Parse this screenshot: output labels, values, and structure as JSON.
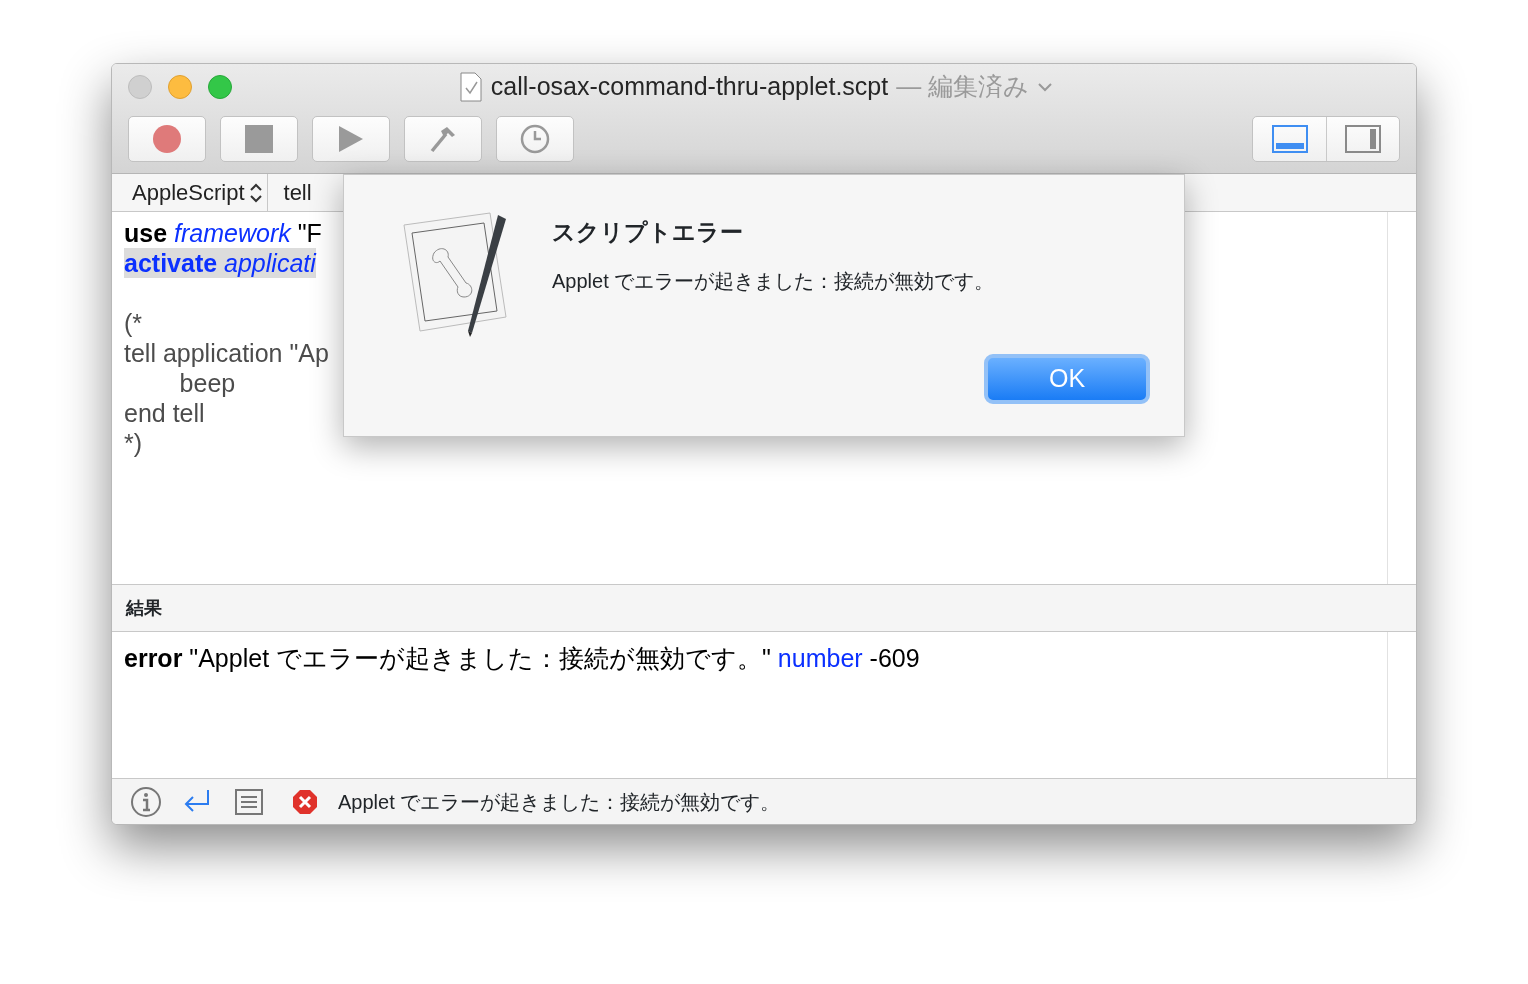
{
  "window": {
    "title": "call-osax-command-thru-applet.scpt",
    "title_suffix": "— 編集済み"
  },
  "toolbar": {
    "view_buttons": [
      {
        "selected": true
      },
      {
        "selected": false
      }
    ]
  },
  "navigation_bar": {
    "language": "AppleScript",
    "target": "tell"
  },
  "editor": {
    "lines": [
      {
        "highlighted": false,
        "tokens": [
          {
            "kind": "keyword",
            "text": "use "
          },
          {
            "kind": "term",
            "text": "framework"
          },
          {
            "kind": "plain",
            "text": " \"F"
          }
        ]
      },
      {
        "highlighted": true,
        "tokens": [
          {
            "kind": "command",
            "text": "activate "
          },
          {
            "kind": "term",
            "text": "applicati"
          }
        ]
      },
      {
        "highlighted": false
      },
      {
        "highlighted": false,
        "tokens": [
          {
            "kind": "comment",
            "text": "(*"
          }
        ]
      },
      {
        "highlighted": false,
        "tokens": [
          {
            "kind": "comment",
            "text": "tell application \"Ap"
          }
        ]
      },
      {
        "highlighted": false,
        "tokens": [
          {
            "kind": "comment",
            "text": "\tbeep"
          }
        ]
      },
      {
        "highlighted": false,
        "tokens": [
          {
            "kind": "comment",
            "text": "end tell"
          }
        ]
      },
      {
        "highlighted": false,
        "tokens": [
          {
            "kind": "comment",
            "text": "*)"
          }
        ]
      }
    ]
  },
  "dialog": {
    "title": "スクリプトエラー",
    "message": "Applet でエラーが起きました：接続が無効です。",
    "button": "OK"
  },
  "result": {
    "heading": "結果",
    "tokens": [
      {
        "kind": "keyword",
        "text": "error"
      },
      {
        "kind": "plain",
        "text": " \"Applet でエラーが起きました：接続が無効です。\" "
      },
      {
        "kind": "blue",
        "text": "number"
      },
      {
        "kind": "plain",
        "text": " -609"
      }
    ]
  },
  "bottom_bar": {
    "tabs": [
      {
        "kind": "info",
        "selected": false
      },
      {
        "kind": "result",
        "selected": true
      },
      {
        "kind": "log",
        "selected": false
      }
    ],
    "status": "Applet でエラーが起きました：接続が無効です。"
  }
}
